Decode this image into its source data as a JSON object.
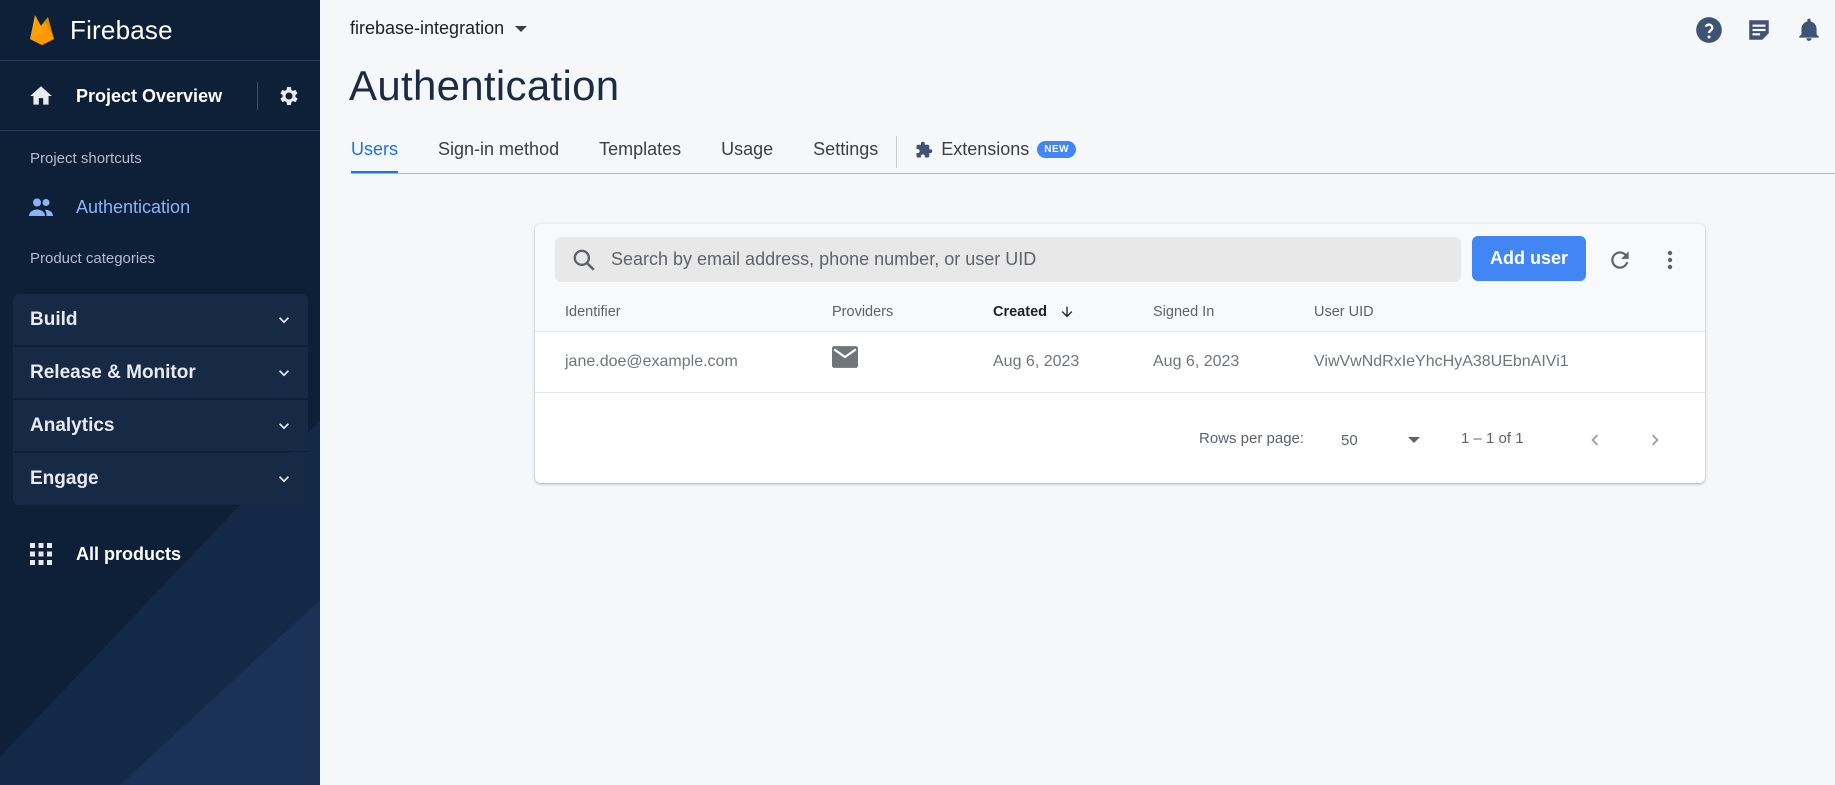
{
  "sidebar": {
    "brand": "Firebase",
    "project_overview": "Project Overview",
    "project_shortcuts_label": "Project shortcuts",
    "shortcut_authentication": "Authentication",
    "product_categories_label": "Product categories",
    "categories": [
      {
        "label": "Build"
      },
      {
        "label": "Release & Monitor"
      },
      {
        "label": "Analytics"
      },
      {
        "label": "Engage"
      }
    ],
    "all_products": "All products"
  },
  "header": {
    "project_name": "firebase-integration",
    "page_title": "Authentication",
    "icons": [
      "help-icon",
      "release-notes-icon",
      "notifications-icon"
    ]
  },
  "tabs": [
    {
      "label": "Users",
      "active": true
    },
    {
      "label": "Sign-in method"
    },
    {
      "label": "Templates"
    },
    {
      "label": "Usage"
    },
    {
      "label": "Settings"
    },
    {
      "label": "Extensions",
      "badge": "NEW"
    }
  ],
  "users_table": {
    "search_placeholder": "Search by email address, phone number, or user UID",
    "add_user_label": "Add user",
    "columns": [
      "Identifier",
      "Providers",
      "Created",
      "Signed In",
      "User UID"
    ],
    "sorted_column": "Created",
    "rows": [
      {
        "identifier": "jane.doe@example.com",
        "provider_icon": "email-icon",
        "created": "Aug 6, 2023",
        "signed_in": "Aug 6, 2023",
        "uid": "ViwVwNdRxIeYhcHyA38UEbnAIVi1"
      }
    ],
    "rows_per_page_label": "Rows per page:",
    "rows_per_page": "50",
    "page_range": "1 – 1 of 1"
  },
  "colors": {
    "sidebar_bg": "#0e2038",
    "accent": "#4285f4",
    "active_tab": "#1a73e8",
    "sidebar_active": "#8ab4f8"
  }
}
